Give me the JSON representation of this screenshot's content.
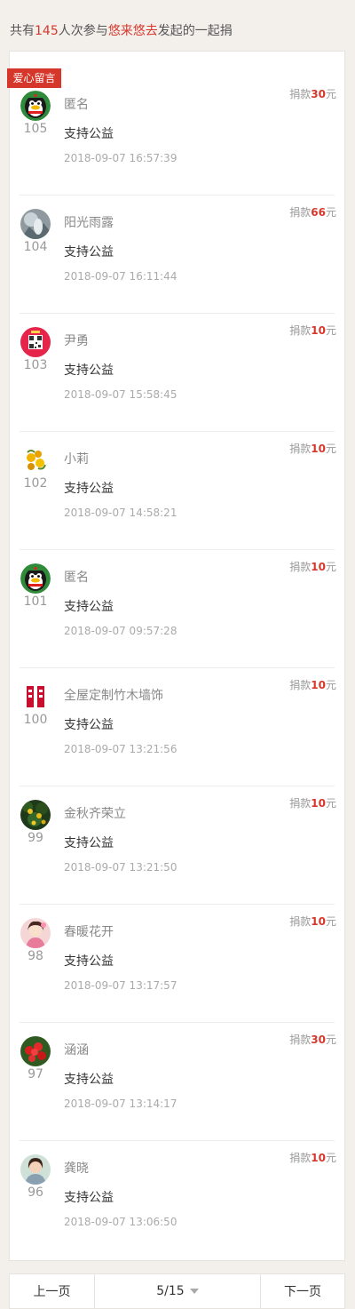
{
  "summary": {
    "prefix": "共有",
    "count": "145",
    "middle": "人次参与",
    "initiator": "悠来悠去",
    "suffix": "发起的一起捐"
  },
  "tag_label": "爱心留言",
  "amount_prefix": "捐款",
  "amount_unit": "元",
  "donations": [
    {
      "rank": "105",
      "name": "匿名",
      "message": "支持公益",
      "time": "2018-09-07 16:57:39",
      "amount": "30",
      "avatar": "qq-penguin-icon"
    },
    {
      "rank": "104",
      "name": "阳光雨露",
      "message": "支持公益",
      "time": "2018-09-07 16:11:44",
      "amount": "66",
      "avatar": "photo-avatar"
    },
    {
      "rank": "103",
      "name": "尹勇",
      "message": "支持公益",
      "time": "2018-09-07 15:58:45",
      "amount": "10",
      "avatar": "qr-avatar"
    },
    {
      "rank": "102",
      "name": "小莉",
      "message": "支持公益",
      "time": "2018-09-07 14:58:21",
      "amount": "10",
      "avatar": "flower-avatar"
    },
    {
      "rank": "101",
      "name": "匿名",
      "message": "支持公益",
      "time": "2018-09-07 09:57:28",
      "amount": "10",
      "avatar": "qq-penguin-icon"
    },
    {
      "rank": "100",
      "name": "全屋定制竹木墙饰",
      "message": "支持公益",
      "time": "2018-09-07 13:21:56",
      "amount": "10",
      "avatar": "logo-avatar"
    },
    {
      "rank": "99",
      "name": "金秋齐荣立",
      "message": "支持公益",
      "time": "2018-09-07 13:21:50",
      "amount": "10",
      "avatar": "fruit-tree-avatar"
    },
    {
      "rank": "98",
      "name": "春暖花开",
      "message": "支持公益",
      "time": "2018-09-07 13:17:57",
      "amount": "10",
      "avatar": "girl-avatar"
    },
    {
      "rank": "97",
      "name": "涵涵",
      "message": "支持公益",
      "time": "2018-09-07 13:14:17",
      "amount": "30",
      "avatar": "red-flowers-avatar"
    },
    {
      "rank": "96",
      "name": "龚晓",
      "message": "支持公益",
      "time": "2018-09-07 13:06:50",
      "amount": "10",
      "avatar": "portrait-avatar"
    }
  ],
  "pager": {
    "prev": "上一页",
    "page": "5/15",
    "next": "下一页"
  },
  "colors": {
    "accent": "#d6372b",
    "background": "#f3f0ec"
  }
}
